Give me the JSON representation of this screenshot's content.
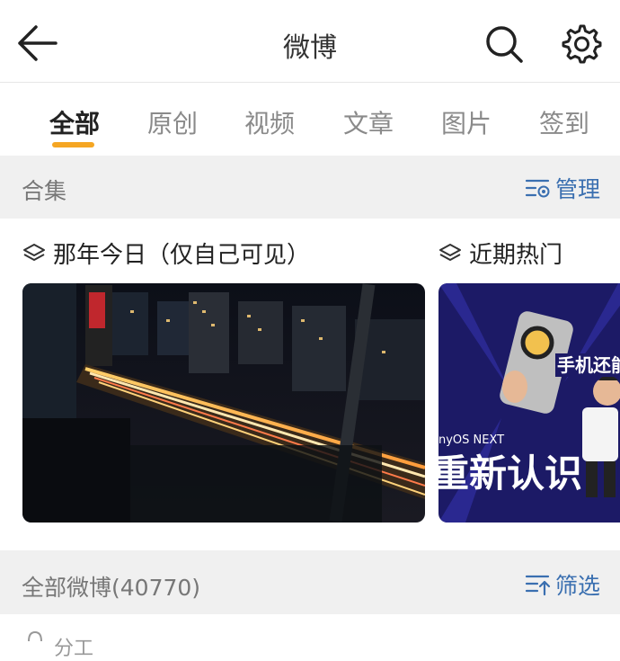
{
  "header": {
    "title": "微博"
  },
  "tabs": [
    {
      "label": "全部",
      "active": true
    },
    {
      "label": "原创"
    },
    {
      "label": "视频"
    },
    {
      "label": "文章"
    },
    {
      "label": "图片"
    },
    {
      "label": "签到"
    }
  ],
  "collections_bar": {
    "label": "合集",
    "action": "管理"
  },
  "collections": [
    {
      "title": "那年今日（仅自己可见）",
      "image": "night-city-traffic-photo"
    },
    {
      "title": "近期热门",
      "image": "phone-promo-thumbnail",
      "overlay_text_1": "手机还能这",
      "overlay_text_2": "nyOS NEXT",
      "overlay_text_3": "重新认识"
    }
  ],
  "all_posts_bar": {
    "label": "全部微博(40770)",
    "action": "筛选"
  },
  "peek": {
    "text": "分工"
  },
  "colors": {
    "accent": "#f5a623",
    "link": "#3a6fb0"
  }
}
